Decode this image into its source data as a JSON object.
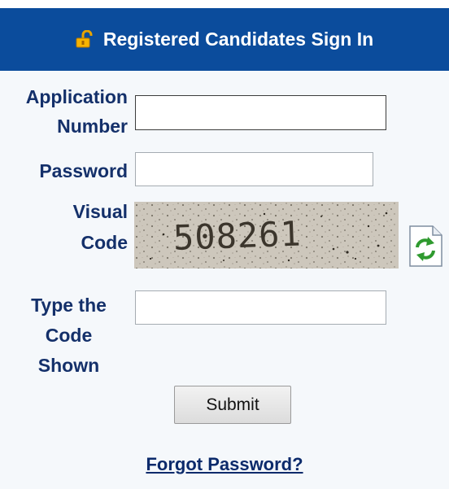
{
  "header": {
    "title": "Registered Candidates Sign In",
    "icon": "unlock-icon"
  },
  "form": {
    "application_number": {
      "label_line1": "Application",
      "label_line2": "Number",
      "value": ""
    },
    "password": {
      "label": "Password",
      "value": ""
    },
    "visual_code": {
      "label_line1": "Visual",
      "label_line2": "Code",
      "captcha_text": "508261",
      "refresh_icon": "refresh-icon"
    },
    "type_code": {
      "label_line1": "Type the",
      "label_line2": "Code",
      "label_line3": "Shown",
      "value": ""
    },
    "submit_label": "Submit"
  },
  "links": {
    "forgot_password": "Forgot Password?"
  },
  "colors": {
    "header_bg": "#0b4c9c",
    "label": "#14306a",
    "link": "#0b2a6b",
    "panel_bg": "#f5f8fb"
  }
}
